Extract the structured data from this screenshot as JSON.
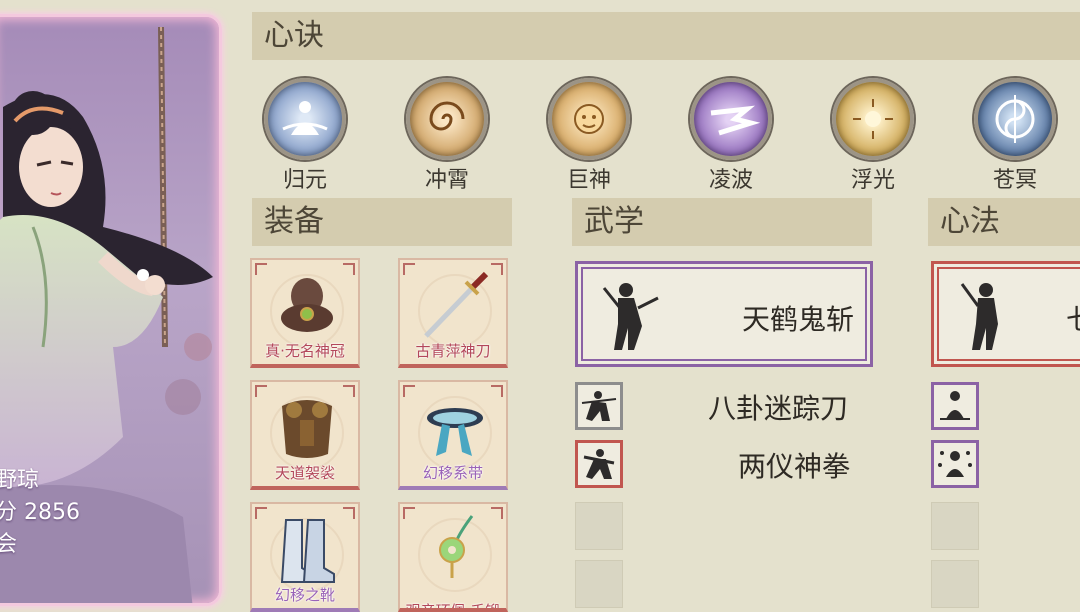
{
  "character": {
    "name_partial": "野琼",
    "score_partial": "分 2856",
    "line3_partial": "会"
  },
  "sections": {
    "xinjue": "心诀",
    "equipment": "装备",
    "wuxue": "武学",
    "xinfa": "心法"
  },
  "xinjue_skills": [
    {
      "label": "归元",
      "color": "#6f8fbf"
    },
    {
      "label": "冲霄",
      "color": "#c99b5a"
    },
    {
      "label": "巨神",
      "color": "#d1a15a"
    },
    {
      "label": "凌波",
      "color": "#8a63b6"
    },
    {
      "label": "浮光",
      "color": "#c9a049"
    },
    {
      "label": "苍冥",
      "color": "#4e6e9c"
    }
  ],
  "equipment": [
    {
      "name": "真·无名神冠",
      "rarity": "red",
      "icon": "hair-crown-icon"
    },
    {
      "name": "古青萍神刀",
      "rarity": "red",
      "icon": "sword-icon"
    },
    {
      "name": "天道袈裟",
      "rarity": "red",
      "icon": "armor-icon"
    },
    {
      "name": "幻移系带",
      "rarity": "purple",
      "icon": "belt-icon"
    },
    {
      "name": "幻移之靴",
      "rarity": "purple",
      "icon": "boots-icon"
    },
    {
      "name": "观音环佩·千锻",
      "rarity": "red",
      "icon": "jade-pendant-icon"
    }
  ],
  "wuxue": {
    "main": "天鹤鬼斩",
    "sub1": "八卦迷踪刀",
    "sub2": "两仪神拳"
  },
  "xinfa": {
    "main_partial": "七"
  }
}
